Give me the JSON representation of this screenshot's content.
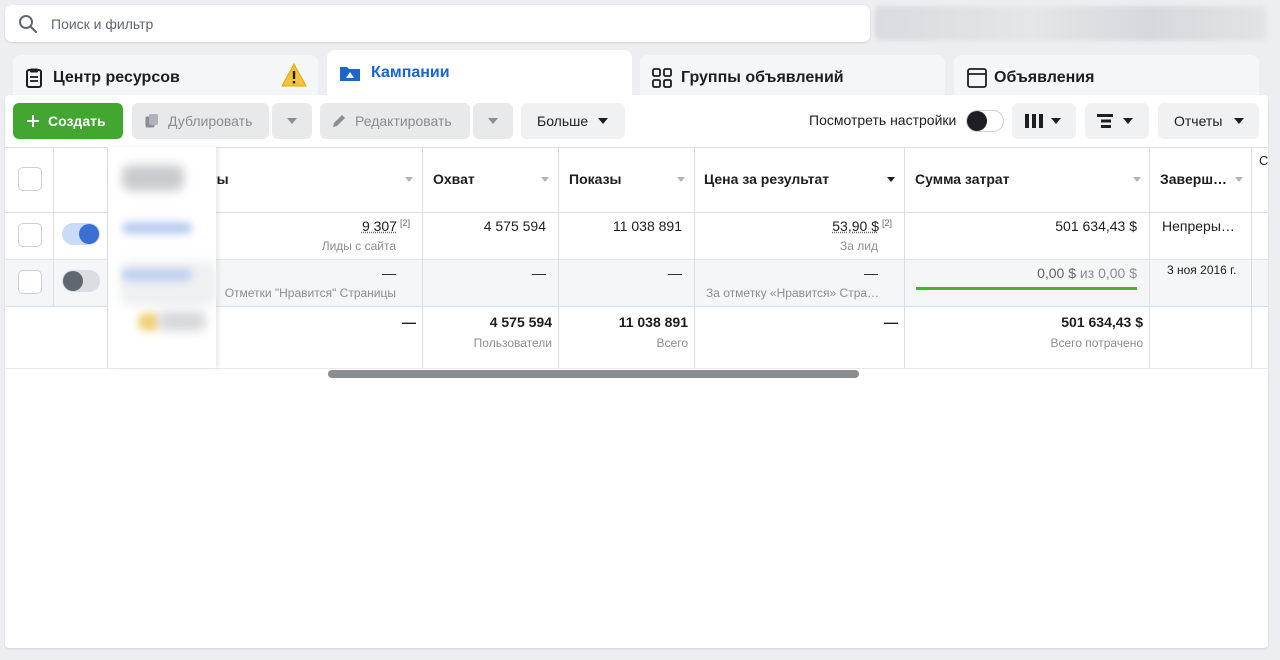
{
  "search": {
    "placeholder": "Поиск и фильтр",
    "icon": "search-icon"
  },
  "tabs": [
    {
      "label": "Центр ресурсов",
      "icon": "clipboard-icon",
      "warning_icon": "warning-icon"
    },
    {
      "label": "Кампании",
      "icon": "campaign-folder-icon",
      "active": true
    },
    {
      "label": "Группы объявлений",
      "icon": "grid-icon"
    },
    {
      "label": "Объявления",
      "icon": "ad-window-icon"
    }
  ],
  "toolbar": {
    "create_label": "Создать",
    "duplicate_label": "Дублировать",
    "edit_label": "Редактировать",
    "more_label": "Больше",
    "view_settings_label": "Посмотреть настройки",
    "view_settings_on": false,
    "reports_label": "Отчеты"
  },
  "table": {
    "headers": {
      "results": "аты",
      "reach": "Охват",
      "impressions": "Показы",
      "cost_per_result": "Цена за результат",
      "amount_spent": "Сумма затрат",
      "ends": "Заверш…",
      "next_partial": "С"
    },
    "rows": [
      {
        "on": true,
        "results": "9 307",
        "results_badge": "[2]",
        "results_sub": "Лиды с сайта",
        "reach": "4 575 594",
        "impressions": "11 038 891",
        "cost_per_result": "53,90 $",
        "cost_badge": "[2]",
        "cost_sub": "За лид",
        "amount_spent": "501 634,43 $",
        "ends": "Непреры…"
      },
      {
        "on": false,
        "results": "—",
        "results_sub": "Отметки \"Нравится\" Страницы",
        "reach": "—",
        "impressions": "—",
        "cost_per_result": "—",
        "cost_sub": "За отметку «Нравится» Стра…",
        "amount_spent": "0,00 $",
        "amount_of": "из",
        "amount_budget": "0,00 $",
        "budget_progress": 1.0,
        "ends": "3 ноя 2016 г."
      }
    ],
    "totals": {
      "results": "—",
      "reach": "4 575 594",
      "reach_sub": "Пользователи",
      "impressions": "11 038 891",
      "impressions_sub": "Всего",
      "cost_per_result": "—",
      "amount_spent": "501 634,43 $",
      "amount_sub": "Всего потрачено"
    }
  },
  "colors": {
    "accent_blue": "#1a66c9",
    "create_green": "#42a730",
    "toggle_on": "#3b6fd4",
    "progress_green": "#42b72a",
    "warning_yellow": "#f5c33b"
  }
}
